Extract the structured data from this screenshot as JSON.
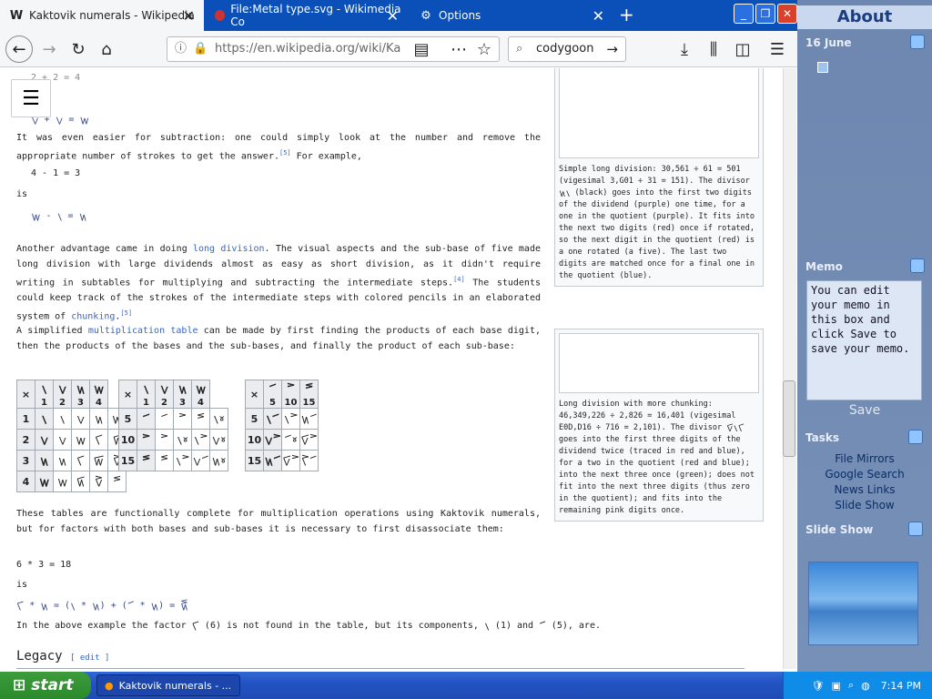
{
  "browser": {
    "tabs": [
      {
        "title": "Kaktovik numerals - Wikipedia",
        "icon": "W",
        "active": true
      },
      {
        "title": "File:Metal type.svg - Wikimedia Co",
        "icon": "",
        "active": false
      },
      {
        "title": "Options",
        "icon": "⚙",
        "active": false
      }
    ],
    "url": "https://en.wikipedia.org/wiki/Ka",
    "search_value": "codygoon"
  },
  "article": {
    "eq0": "2 + 2 = 4",
    "eq0b": "𝋂 + 𝋂 = 𝋄",
    "p1": "It was even easier for subtraction: one could simply look at the number and remove the appropriate number of strokes to get the answer.",
    "p1_ref": "[5]",
    "p1_tail": " For example,",
    "eq1": "4 - 1 = 3",
    "is1": "is",
    "eq1b": "𝋄 - 𝋁 = 𝋃",
    "p2a": "Another advantage came in doing ",
    "p2_link": "long division",
    "p2b": ". The visual aspects and the sub-base of five made long division with large dividends almost as easy as short division, as it didn't require writing in subtables for multiplying and subtracting the intermediate steps.",
    "p2_ref": "[4]",
    "p2c": " The students could keep track of the strokes of the intermediate steps with colored pencils in an elaborated system of ",
    "p2_link2": "chunking",
    "p2_ref2": "[5]",
    "p3a": "A simplified ",
    "p3_link": "multiplication table",
    "p3b": " can be made by first finding the products of each base digit, then the products of the bases and the sub-bases, and finally the product of each sub-base:",
    "p4": "These tables are functionally complete for multiplication operations using Kaktovik numerals, but for factors with both bases and sub-bases it is necessary to first disassociate them:",
    "eq2": "6 * 3 = 18",
    "is2": "is",
    "eq2b": "𝋆 * 𝋃 = (𝋁 * 𝋃) + (𝋅 * 𝋃) = 𝋒",
    "p5": "In the above example the factor 𝋆 (6) is not found in the table, but its components, 𝋁 (1) and 𝋅 (5), are.",
    "heading": "Legacy",
    "edit": "[ edit ]",
    "fig1": "Simple long division: 30,561 ÷ 61 = 501 (vigesimal 3,G01 ÷ 31 = 151). The divisor 𝋃𝋁 (black) goes into the first two digits of the dividend (purple) one time, for a one in the quotient (purple). It fits into the next two digits (red) once if rotated, so the next digit in the quotient (red) is a one rotated (a five). The last two digits are matched once for a final one in the quotient (blue).",
    "fig2": "Long division with more chunking: 46,349,226 ÷ 2,826 = 16,401 (vigesimal E0D,D16 ÷ 716 = 2,101). The divisor 𝋇𝋁𝋆 goes into the first three digits of the dividend twice (traced in red and blue), for a two in the quotient (red and blue); into the next three once (green); does not fit into the next three digits (thus zero in the quotient); and fits into the remaining pink digits once."
  },
  "table1": {
    "head": [
      "×",
      "𝋁",
      "𝋂",
      "𝋃",
      "𝋄"
    ],
    "subhead": [
      "",
      "1",
      "2",
      "3",
      "4"
    ],
    "rows": [
      [
        "1",
        "𝋁",
        "𝋁",
        "𝋂",
        "𝋃",
        "𝋄"
      ],
      [
        "2",
        "𝋂",
        "𝋂",
        "𝋄",
        "𝋆",
        "𝋈"
      ],
      [
        "3",
        "𝋃",
        "𝋃",
        "𝋆",
        "𝋉",
        "𝋌"
      ],
      [
        "4",
        "𝋄",
        "𝋄",
        "𝋈",
        "𝋌",
        "𝋏"
      ]
    ]
  },
  "table2": {
    "head": [
      "×",
      "𝋁",
      "𝋂",
      "𝋃",
      "𝋄"
    ],
    "subhead": [
      "",
      "1",
      "2",
      "3",
      "4"
    ],
    "rows": [
      [
        "5",
        "𝋅",
        "𝋅",
        "𝋊",
        "𝋏",
        "𝋁𝋀"
      ],
      [
        "10",
        "𝋊",
        "𝋊",
        "𝋁𝋀",
        "𝋁𝋊",
        "𝋂𝋀"
      ],
      [
        "15",
        "𝋏",
        "𝋏",
        "𝋁𝋊",
        "𝋂𝋅",
        "𝋃𝋀"
      ]
    ]
  },
  "table3": {
    "head": [
      "×",
      "𝋅",
      "𝋊",
      "𝋏"
    ],
    "subhead": [
      "",
      "5",
      "10",
      "15"
    ],
    "rows": [
      [
        "5",
        "𝋁𝋅",
        "𝋁𝋊",
        "𝋃𝋅"
      ],
      [
        "10",
        "𝋂𝋊",
        "𝋅𝋀",
        "𝋇𝋊"
      ],
      [
        "15",
        "𝋃𝋅",
        "𝋇𝋊",
        "𝋋𝋅"
      ]
    ]
  },
  "sidebar": {
    "title": "About",
    "date": "16 June",
    "memo_title": "Memo",
    "memo_text": "You can edit your memo in this box and click Save to save your memo.",
    "save": "Save",
    "tasks_title": "Tasks",
    "tasks": [
      "File Mirrors",
      "Google Search",
      "News Links",
      "Slide Show"
    ],
    "slideshow_title": "Slide Show"
  },
  "taskbar": {
    "start": "start",
    "item": "Kaktovik numerals - ...",
    "time": "7:14 PM"
  }
}
